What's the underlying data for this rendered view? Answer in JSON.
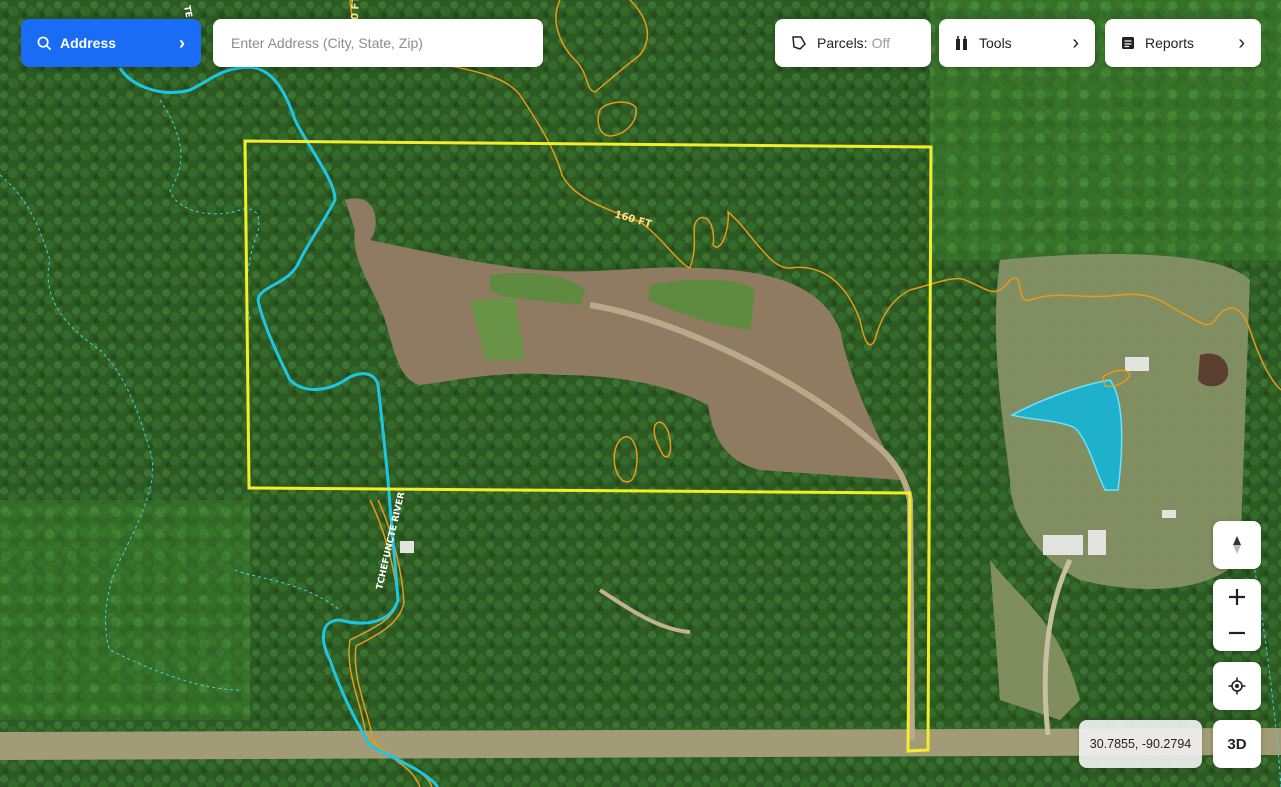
{
  "search": {
    "mode_label": "Address",
    "placeholder": "Enter Address (City, State, Zip)"
  },
  "toolbar": {
    "parcels_label": "Parcels:",
    "parcels_state": "Off",
    "tools_label": "Tools",
    "reports_label": "Reports"
  },
  "map": {
    "contour_label": "160 FT",
    "river_label": "TCHEFUNCTE RIVER",
    "river_label_top": "TE",
    "contour_label_top": "0 FT",
    "parcel_outline_color": "#f2ee2a",
    "river_color": "#1ec6e6",
    "contour_color": "#e89a1a",
    "pond_color": "#1fb1cc"
  },
  "controls": {
    "coords": "30.7855, -90.2794",
    "three_d_label": "3D"
  },
  "icons": {
    "search": "search-icon",
    "parcels": "parcel-shape-icon",
    "tools": "tools-icon",
    "reports": "report-icon",
    "compass": "compass-icon",
    "zoom_in": "plus-icon",
    "zoom_out": "minus-icon",
    "locate": "locate-icon"
  }
}
